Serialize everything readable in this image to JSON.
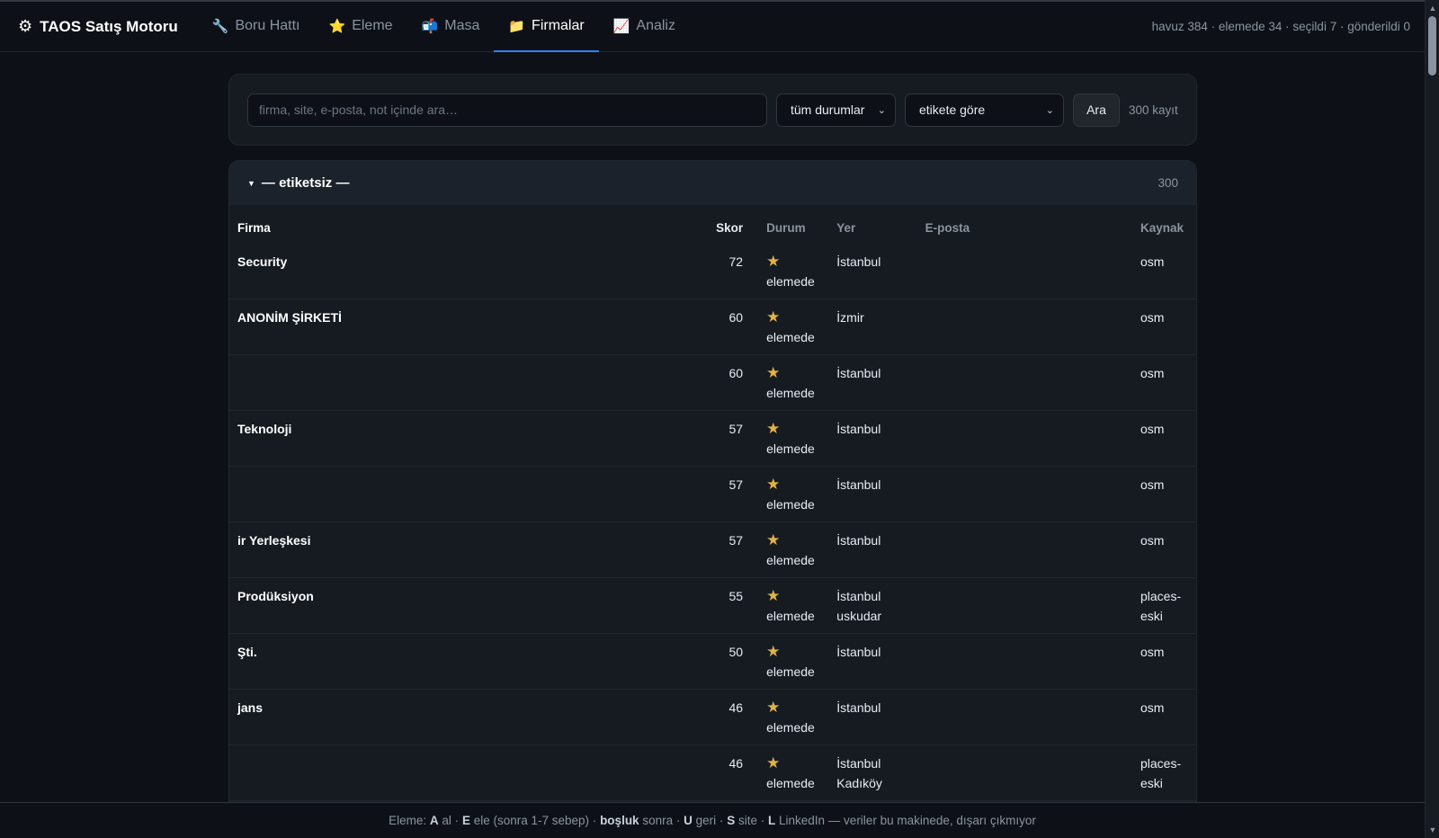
{
  "header": {
    "brand": "TAOS Satış Motoru",
    "brand_icon": "gear-icon",
    "nav": [
      {
        "label": "Boru Hattı",
        "icon": "wrench-icon",
        "glyph": "🔧"
      },
      {
        "label": "Eleme",
        "icon": "star-icon",
        "glyph": "⭐"
      },
      {
        "label": "Masa",
        "icon": "mailbox-icon",
        "glyph": "📬"
      },
      {
        "label": "Firmalar",
        "icon": "folder-icon",
        "glyph": "📁"
      },
      {
        "label": "Analiz",
        "icon": "chart-icon",
        "glyph": "📈"
      }
    ],
    "active_nav": "Firmalar",
    "stats": "havuz 384 · elemede 34 · seçildi 7 · gönderildi 0"
  },
  "search": {
    "placeholder": "firma, site, e-posta, not içinde ara…",
    "status_select": "tüm durumlar",
    "tag_select": "etikete göre",
    "button": "Ara",
    "count": "300 kayıt"
  },
  "group": {
    "title": "— etiketsiz —",
    "count": "300",
    "columns": {
      "firma": "Firma",
      "skor": "Skor",
      "durum": "Durum",
      "yer": "Yer",
      "eposta": "E-posta",
      "kaynak": "Kaynak"
    },
    "rows": [
      {
        "firma": "Security",
        "skor": "72",
        "durum": "elemede",
        "yer": "İstanbul",
        "yer2": "",
        "eposta": "",
        "kaynak": "osm"
      },
      {
        "firma": "ANONİM ŞİRKETİ",
        "skor": "60",
        "durum": "elemede",
        "yer": "İzmir",
        "yer2": "",
        "eposta": "",
        "kaynak": "osm"
      },
      {
        "firma": "",
        "skor": "60",
        "durum": "elemede",
        "yer": "İstanbul",
        "yer2": "",
        "eposta": "",
        "kaynak": "osm"
      },
      {
        "firma": "Teknoloji",
        "skor": "57",
        "durum": "elemede",
        "yer": "İstanbul",
        "yer2": "",
        "eposta": "",
        "kaynak": "osm"
      },
      {
        "firma": "",
        "skor": "57",
        "durum": "elemede",
        "yer": "İstanbul",
        "yer2": "",
        "eposta": "",
        "kaynak": "osm"
      },
      {
        "firma": "ir Yerleşkesi",
        "skor": "57",
        "durum": "elemede",
        "yer": "İstanbul",
        "yer2": "",
        "eposta": "",
        "kaynak": "osm"
      },
      {
        "firma": "Prodüksiyon",
        "skor": "55",
        "durum": "elemede",
        "yer": "İstanbul",
        "yer2": "uskudar",
        "eposta": "",
        "kaynak": "places-eski"
      },
      {
        "firma": "Şti.",
        "skor": "50",
        "durum": "elemede",
        "yer": "İstanbul",
        "yer2": "",
        "eposta": "",
        "kaynak": "osm"
      },
      {
        "firma": "jans",
        "skor": "46",
        "durum": "elemede",
        "yer": "İstanbul",
        "yer2": "",
        "eposta": "",
        "kaynak": "osm"
      },
      {
        "firma": "",
        "skor": "46",
        "durum": "elemede",
        "yer": "İstanbul",
        "yer2": "Kadıköy",
        "eposta": "",
        "kaynak": "places-eski"
      }
    ]
  },
  "footer": {
    "prefix": "Eleme:",
    "k1": "A",
    "t1": "al ·",
    "k2": "E",
    "t2": "ele (sonra 1-7 sebep) ·",
    "k3": "boşluk",
    "t3": "sonra ·",
    "k4": "U",
    "t4": "geri ·",
    "k5": "S",
    "t5": "site ·",
    "k6": "L",
    "t6": "LinkedIn — veriler bu makinede, dışarı çıkmıyor"
  },
  "colors": {
    "background": "#0d1117",
    "panel": "#161b22",
    "accent": "#2f81f7",
    "star": "#e3b341"
  }
}
